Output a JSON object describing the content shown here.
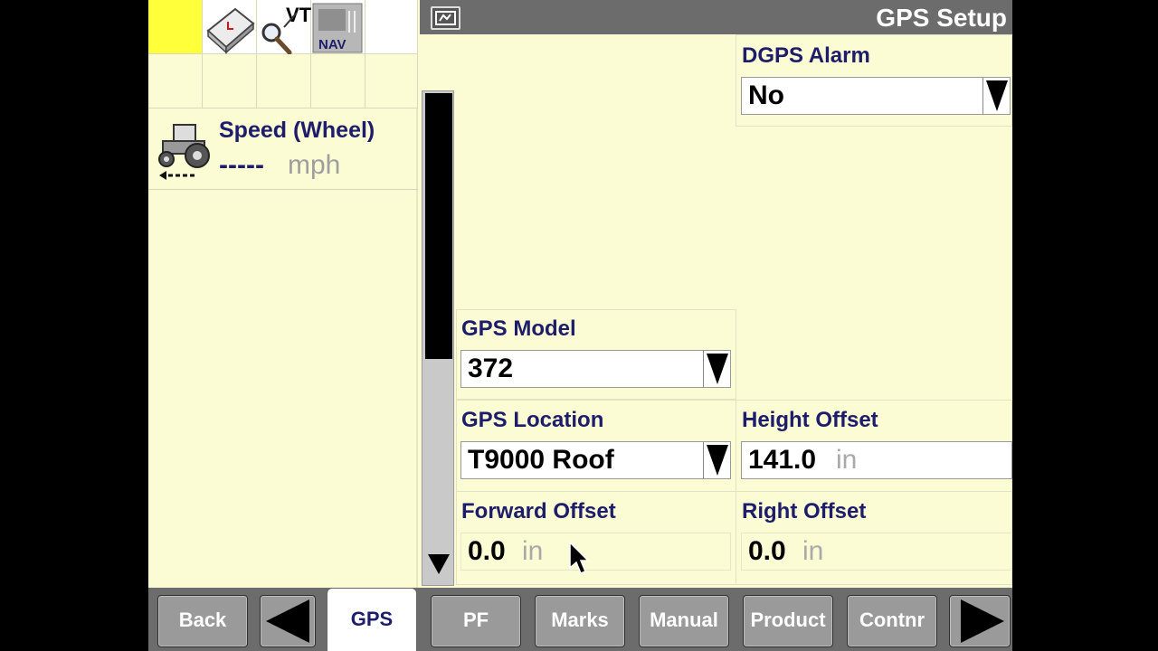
{
  "screen": {
    "title": "GPS Setup"
  },
  "launcher": {
    "icons": [
      "active-slot",
      "book-icon",
      "vt-search-icon",
      "nav-module-icon"
    ],
    "vt_label": "VT",
    "nav_label": "NAV"
  },
  "speed": {
    "label": "Speed (Wheel)",
    "value": "-----",
    "unit": "mph"
  },
  "fields": {
    "dgps_alarm": {
      "label": "DGPS Alarm",
      "value": "No"
    },
    "gps_model": {
      "label": "GPS Model",
      "value": "372"
    },
    "gps_location": {
      "label": "GPS Location",
      "value": "T9000 Roof"
    },
    "height_offset": {
      "label": "Height Offset",
      "value": "141.0",
      "unit": "in"
    },
    "forward_offset": {
      "label": "Forward Offset",
      "value": "0.0",
      "unit": "in"
    },
    "right_offset": {
      "label": "Right Offset",
      "value": "0.0",
      "unit": "in"
    }
  },
  "softkeys": {
    "back": "Back",
    "gps": "GPS",
    "pf": "PF",
    "marks": "Marks",
    "manual": "Manual",
    "product": "Product",
    "contnr": "Contnr"
  },
  "colors": {
    "background": "#fbfbd4",
    "highlight": "#ffff3a",
    "label_text": "#1d1d6b",
    "softkey_bar": "#6c6c6c",
    "softkey": "#9a9a9a"
  }
}
